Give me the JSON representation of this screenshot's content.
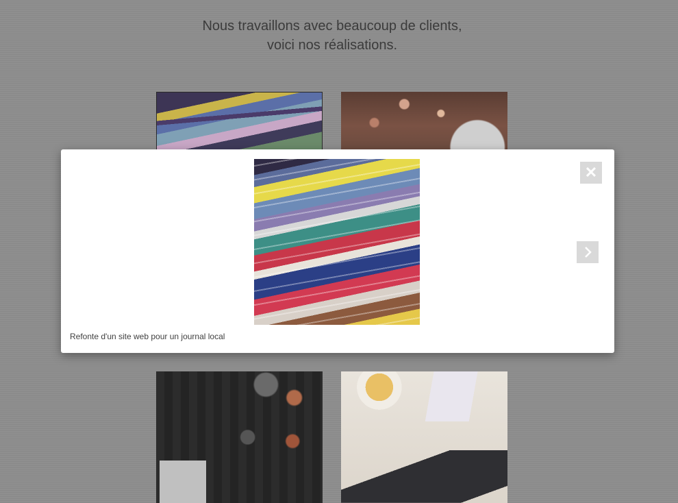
{
  "intro": {
    "line1": "Nous travaillons avec beaucoup de clients,",
    "line2": "voici nos réalisations."
  },
  "portfolio": {
    "items": [
      {
        "image": "magazines-stack"
      },
      {
        "image": "bokeh-camera"
      },
      {
        "image": "camera-gear-flatlay"
      },
      {
        "image": "desk-laptop-flatlay"
      }
    ]
  },
  "lightbox": {
    "image": "magazines-stack",
    "caption": "Refonte d'un site web pour un journal local",
    "close_icon": "✕",
    "next_icon": "chevron-right-icon"
  }
}
